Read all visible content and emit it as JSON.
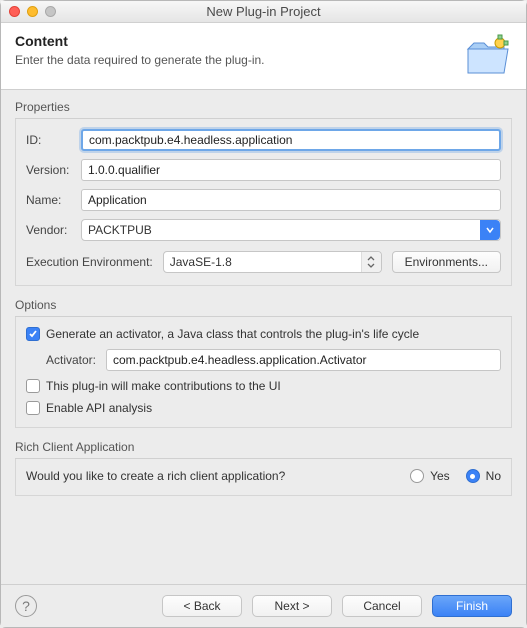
{
  "window": {
    "title": "New Plug-in Project"
  },
  "header": {
    "title": "Content",
    "subtitle": "Enter the data required to generate the plug-in."
  },
  "properties": {
    "section_label": "Properties",
    "id_label": "ID:",
    "id_value": "com.packtpub.e4.headless.application",
    "version_label": "Version:",
    "version_value": "1.0.0.qualifier",
    "name_label": "Name:",
    "name_value": "Application",
    "vendor_label": "Vendor:",
    "vendor_value": "PACKTPUB",
    "exec_env_label": "Execution Environment:",
    "exec_env_value": "JavaSE-1.8",
    "env_button": "Environments..."
  },
  "options": {
    "section_label": "Options",
    "generate_activator_label": "Generate an activator, a Java class that controls the plug-in's life cycle",
    "activator_label": "Activator:",
    "activator_value": "com.packtpub.e4.headless.application.Activator",
    "ui_contrib_label": "This plug-in will make contributions to the UI",
    "api_analysis_label": "Enable API analysis"
  },
  "rcp": {
    "section_label": "Rich Client Application",
    "question": "Would you like to create a rich client application?",
    "yes": "Yes",
    "no": "No"
  },
  "footer": {
    "back": "< Back",
    "next": "Next >",
    "cancel": "Cancel",
    "finish": "Finish"
  }
}
